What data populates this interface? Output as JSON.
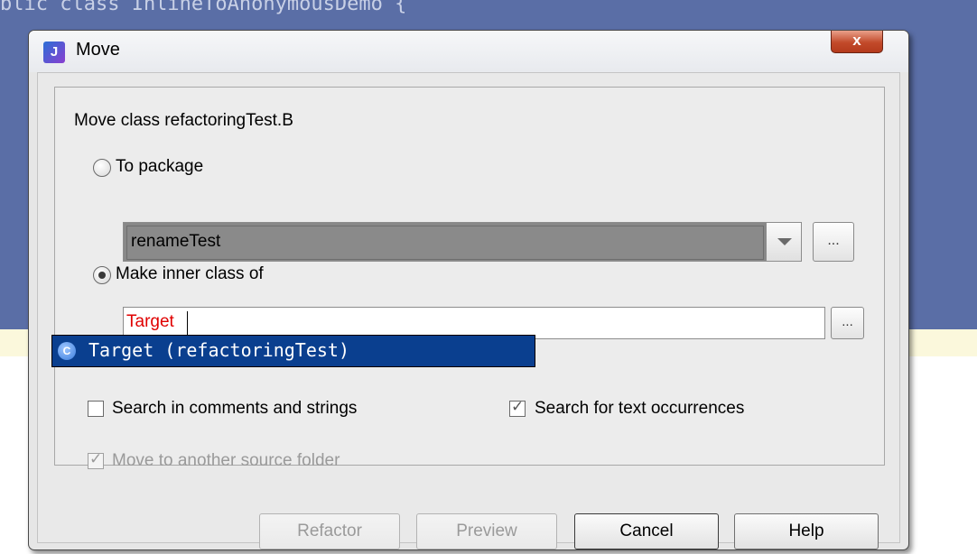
{
  "background_editor": {
    "code_line": "blic class InlineToAnonymousDemo {"
  },
  "dialog": {
    "title": "Move",
    "close_label": "x",
    "app_icon_label": "J",
    "heading": "Move class refactoringTest.B",
    "to_package": {
      "label": "To package",
      "selected": false,
      "value": "renameTest",
      "browse_label": "..."
    },
    "make_inner_class": {
      "label": "Make inner class of",
      "selected": true,
      "value": "Target",
      "browse_label": "..."
    },
    "autocomplete": {
      "icon_label": "C",
      "item": "Target (refactoringTest)"
    },
    "options": {
      "search_comments": {
        "label": "Search in comments and strings",
        "checked": false
      },
      "search_text": {
        "label": "Search for text occurrences",
        "checked": true
      },
      "move_source_folder": {
        "label": "Move to another source folder",
        "checked": true,
        "disabled": true
      }
    },
    "buttons": {
      "refactor": "Refactor",
      "preview": "Preview",
      "cancel": "Cancel",
      "help": "Help"
    }
  },
  "colors": {
    "editor_bg": "#5a6ea6",
    "popup_selection": "#0a3f8f",
    "target_text": "#e00000"
  }
}
